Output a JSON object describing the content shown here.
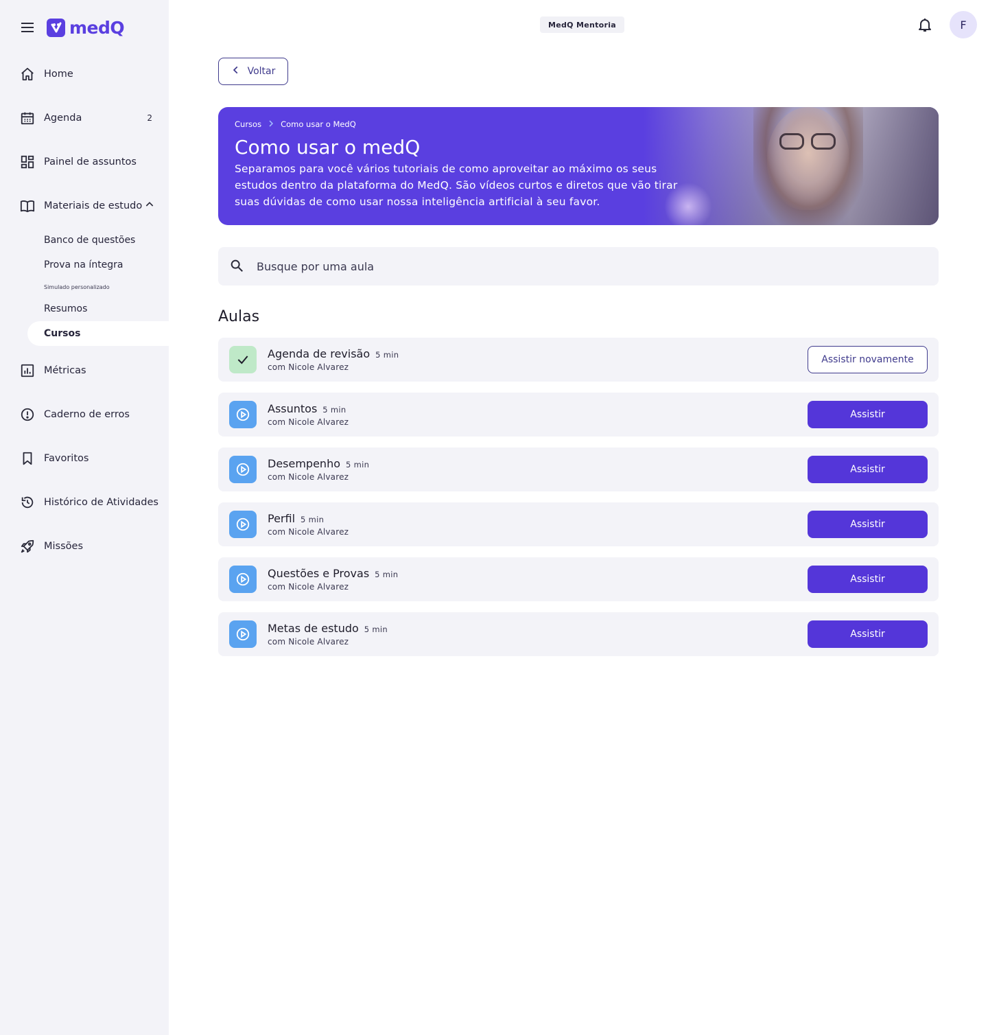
{
  "brand": {
    "name": "medQ",
    "primary_color": "#5a3fe0"
  },
  "topbar": {
    "mentoria_label": "MedQ Mentoria",
    "avatar_initial": "F"
  },
  "sidebar": {
    "items": [
      {
        "id": "home",
        "label": "Home",
        "icon": "home-icon"
      },
      {
        "id": "agenda",
        "label": "Agenda",
        "icon": "calendar-icon",
        "badge": "2"
      },
      {
        "id": "painel",
        "label": "Painel de assuntos",
        "icon": "dashboard-icon"
      },
      {
        "id": "materiais",
        "label": "Materiais de estudo",
        "icon": "book-icon"
      }
    ],
    "sub_items": [
      {
        "label": "Banco de questões"
      },
      {
        "label": "Prova na íntegra"
      },
      {
        "label": "Simulado personalizado"
      },
      {
        "label": "Resumos"
      },
      {
        "label": "Cursos"
      }
    ],
    "items_bottom": [
      {
        "id": "metricas",
        "label": "Métricas",
        "icon": "chart-icon"
      },
      {
        "id": "caderno",
        "label": "Caderno de erros",
        "icon": "alert-circle-icon"
      },
      {
        "id": "favoritos",
        "label": "Favoritos",
        "icon": "bookmark-icon"
      },
      {
        "id": "historico",
        "label": "Histórico de Atividades",
        "icon": "history-icon"
      },
      {
        "id": "missoes",
        "label": "Missões",
        "icon": "rocket-icon"
      }
    ]
  },
  "back_button": {
    "label": "Voltar"
  },
  "banner": {
    "breadcrumb": [
      "Cursos",
      "Como usar o MedQ"
    ],
    "title": "Como usar o medQ",
    "description": "Separamos para você vários tutoriais de como aproveitar ao máximo os seus estudos dentro da plataforma do MedQ. São vídeos curtos e diretos que vão tirar suas dúvidas de como usar nossa inteligência artificial à seu favor."
  },
  "search": {
    "placeholder": "Busque por uma aula",
    "value": ""
  },
  "lessons_section": {
    "title": "Aulas"
  },
  "lessons": [
    {
      "title": "Agenda de revisão",
      "duration": "5 min",
      "author": "com Nicole Alvarez",
      "status": "done",
      "button": "Assistir novamente"
    },
    {
      "title": "Assuntos",
      "duration": "5 min",
      "author": "com Nicole Alvarez",
      "status": "todo",
      "button": "Assistir"
    },
    {
      "title": "Desempenho",
      "duration": "5 min",
      "author": "com Nicole Alvarez",
      "status": "todo",
      "button": "Assistir"
    },
    {
      "title": "Perfil",
      "duration": "5 min",
      "author": "com Nicole Alvarez",
      "status": "todo",
      "button": "Assistir"
    },
    {
      "title": "Questões e Provas",
      "duration": "5 min",
      "author": "com Nicole Alvarez",
      "status": "todo",
      "button": "Assistir"
    },
    {
      "title": "Metas de estudo",
      "duration": "5 min",
      "author": "com Nicole Alvarez",
      "status": "todo",
      "button": "Assistir"
    }
  ],
  "colors": {
    "accent": "#5436d9",
    "done_bg": "#bfe9c8",
    "play_bg": "#5aa3f0",
    "sidebar_bg": "#f3f3f8"
  }
}
